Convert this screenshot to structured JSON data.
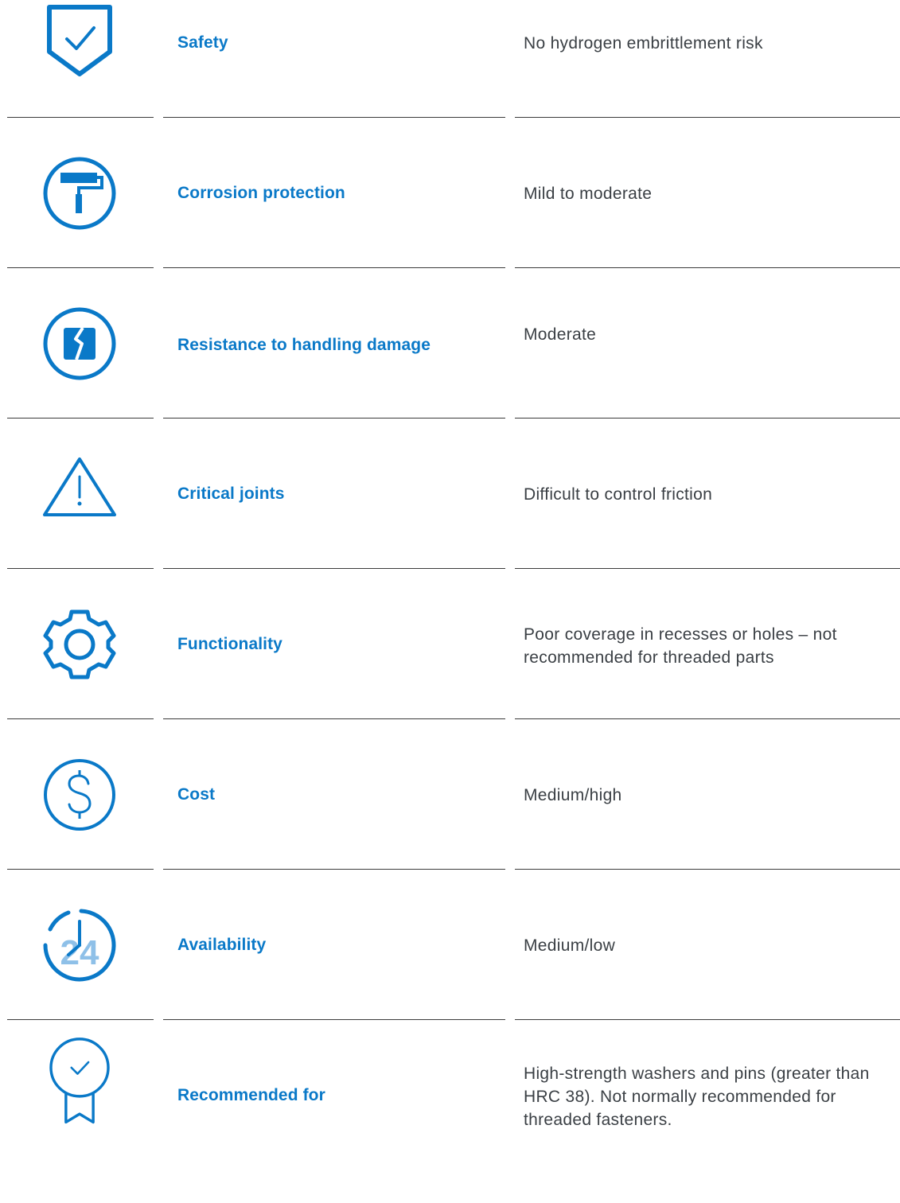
{
  "rows": [
    {
      "icon": "shield-check-icon",
      "feature": "Safety",
      "value": "No hydrogen embrittlement risk"
    },
    {
      "icon": "paint-roller-icon",
      "feature": "Corrosion protection",
      "value": "Mild to moderate"
    },
    {
      "icon": "cracked-block-icon",
      "feature": "Resistance to handling damage",
      "value": "Moderate"
    },
    {
      "icon": "warning-triangle-icon",
      "feature": "Critical joints",
      "value": "Difficult to control friction"
    },
    {
      "icon": "gear-icon",
      "feature": "Functionality",
      "value": "Poor coverage in recesses or holes – not recommended for threaded parts"
    },
    {
      "icon": "dollar-circle-icon",
      "feature": "Cost",
      "value": "Medium/high"
    },
    {
      "icon": "clock-24-icon",
      "feature": "Availability",
      "value": "Medium/low"
    },
    {
      "icon": "award-ribbon-icon",
      "feature": "Recommended for",
      "value": "High-strength washers and pins (greater than HRC 38). Not normally recommended for threaded fasteners."
    }
  ],
  "icon_text": {
    "clock_number": "24"
  },
  "colors": {
    "accent": "#0a79c8",
    "accent_light": "#8ec0e8",
    "text": "#3a3f44",
    "rule": "#3b3b3b"
  }
}
